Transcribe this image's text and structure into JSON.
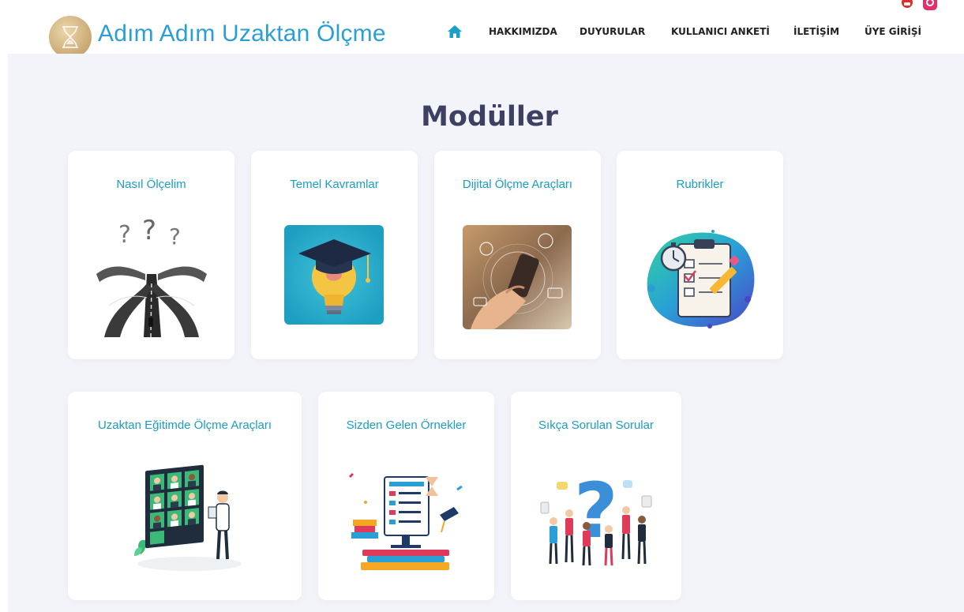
{
  "header": {
    "site_title": "Adım Adım Uzaktan Ölçme",
    "nav": [
      {
        "label": "HAKKIMIZDA"
      },
      {
        "label": "DUYURULAR"
      },
      {
        "label": "KULLANICI ANKETİ"
      },
      {
        "label": "İLETİŞİM"
      },
      {
        "label": "ÜYE GİRİŞİ"
      }
    ],
    "icons": [
      "hourglass-logo-icon",
      "home-icon",
      "youtube-icon",
      "instagram-icon"
    ]
  },
  "main": {
    "title": "Modüller",
    "cards": [
      {
        "title": "Nasıl Ölçelim",
        "image": "crossroads-question-marks-illustration"
      },
      {
        "title": "Temel Kavramlar",
        "image": "lightbulb-graduation-cap-illustration"
      },
      {
        "title": "Dijital Ölçme Araçları",
        "image": "hand-with-phone-digital-illustration"
      },
      {
        "title": "Rubrikler",
        "image": "clipboard-checklist-stopwatch-illustration"
      },
      {
        "title": "Uzaktan Eğitimde Ölçme Araçları",
        "image": "video-call-screen-illustration"
      },
      {
        "title": "Sizden Gelen Örnekler",
        "image": "computer-books-hourglass-illustration"
      },
      {
        "title": "Sıkça Sorulan Sorular",
        "image": "people-question-mark-illustration"
      }
    ]
  },
  "colors": {
    "title_blue": "#2a9fd6",
    "card_title": "#1a9dc4",
    "heading": "#3d3f63",
    "background": "#f2f4fa",
    "youtube": "#e22a2a",
    "instagram": "#e1306c"
  }
}
